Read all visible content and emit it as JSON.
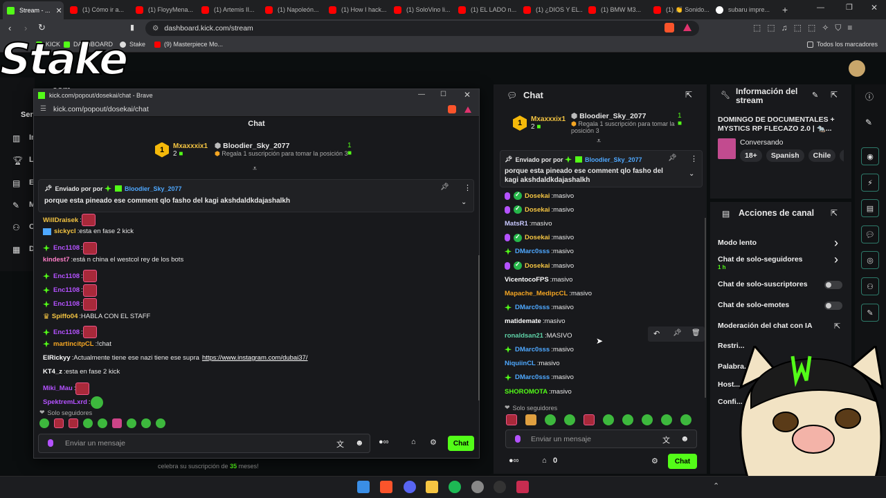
{
  "browser": {
    "tabs": [
      {
        "label": "Stream - ...",
        "kind": "kick",
        "active": true
      },
      {
        "label": "(1) Cómo ir a...",
        "kind": "yt"
      },
      {
        "label": "(1) FloyyMena...",
        "kind": "yt"
      },
      {
        "label": "(1) Artemis II...",
        "kind": "yt"
      },
      {
        "label": "(1) Napoleón...",
        "kind": "yt"
      },
      {
        "label": "(1) How I hack...",
        "kind": "yt"
      },
      {
        "label": "(1) SoloVino li...",
        "kind": "yt"
      },
      {
        "label": "(1) EL LADO n...",
        "kind": "yt"
      },
      {
        "label": "(1) ¿DIOS Y EL...",
        "kind": "yt"
      },
      {
        "label": "(1) BMW M3...",
        "kind": "yt"
      },
      {
        "label": "(1) 👏 Sonido...",
        "kind": "yt"
      },
      {
        "label": "subaru impre...",
        "kind": "g"
      }
    ],
    "url": "dashboard.kick.com/stream",
    "bookmarks": [
      "KICK",
      "DASHBOARD",
      "Stake",
      "(9) Masterpiece Mo..."
    ],
    "all_bookmarks": "Todos los marcadores"
  },
  "logo": {
    "brand": "Stake",
    "suffix": ".com"
  },
  "popout": {
    "window_title": "kick.com/popout/dosekai/chat - Brave",
    "url": "kick.com/popout/dosekai/chat",
    "header": "Chat",
    "gift_rank": "1",
    "gift_user1": "Mxaxxxix1",
    "gift_user1_count": "2",
    "gift_user2": "Bloodier_Sky_2077",
    "gift_user2_count": "1",
    "gift_text": "Regala 1 suscripción para tomar la posición 3",
    "pinned_by_label": "Enviado por",
    "pinned_by_user": "Bloodier_Sky_2077",
    "pinned_text": "porque esta pineado ese comment qlo fasho del kagi akshdaldkdajashalkh",
    "messages": [
      {
        "user": "WillDraisek",
        "color": "#f5c542",
        "badge": "",
        "text": "",
        "emote": true
      },
      {
        "user": "sickycl",
        "color": "#f5c542",
        "badge": "blue",
        "text": "esta en fase 2 kick"
      },
      {
        "user": "Enc1108",
        "color": "#b452ff",
        "badge": "g",
        "text": "",
        "emote": true
      },
      {
        "user": "kindest7",
        "color": "#ff7ec7",
        "badge": "",
        "text": "está n china el westcol rey de los bots"
      },
      {
        "user": "Enc1108",
        "color": "#b452ff",
        "badge": "g",
        "text": "",
        "emote": true
      },
      {
        "user": "Enc1108",
        "color": "#b452ff",
        "badge": "g",
        "text": "",
        "emote": true
      },
      {
        "user": "Enc1108",
        "color": "#b452ff",
        "badge": "g",
        "text": "",
        "emote": true
      },
      {
        "user": "Spiffo04",
        "color": "#f5c542",
        "badge": "crown",
        "text": "HABLA CON EL STAFF"
      },
      {
        "user": "Enc1108",
        "color": "#b452ff",
        "badge": "g",
        "text": "",
        "emote": true
      },
      {
        "user": "martincitpCL",
        "color": "#f5a623",
        "badge": "g",
        "text": "!chat"
      },
      {
        "user": "ElRickyy",
        "color": "#ffffff",
        "badge": "",
        "text": "Actualmente tiene ese nazi tiene ese supra",
        "link": "https://www.instagram.com/dubai37/"
      },
      {
        "user": "KT4_z",
        "color": "#ffffff",
        "badge": "",
        "text": "esta en fase 2 kick"
      },
      {
        "user": "Miki_Mau",
        "color": "#b452ff",
        "badge": "",
        "text": "",
        "emote": true
      },
      {
        "user": "SpektremLxrd",
        "color": "#b452ff",
        "badge": "",
        "text": "",
        "emote": true
      }
    ],
    "followers_only": "Solo seguidores",
    "input_placeholder": "Enviar un mensaje",
    "chat_button": "Chat"
  },
  "chat_panel": {
    "title": "Chat",
    "gift_rank": "1",
    "gift_user1": "Mxaxxxix1",
    "gift_user1_count": "2",
    "gift_user2": "Bloodier_Sky_2077",
    "gift_user2_count": "1",
    "gift_text": "Regala 1 suscripción para tomar la posición 3",
    "pinned_by_label": "Enviado por",
    "pinned_by_user": "Bloodier_Sky_2077",
    "pinned_text": "porque esta pineado ese comment qlo fasho del kagi akshdaldkdajashalkh",
    "messages": [
      {
        "user": "Dosekai",
        "color": "#f5c542",
        "badges": [
          "p",
          "v"
        ],
        "text": "masivo"
      },
      {
        "user": "Dosekai",
        "color": "#f5c542",
        "badges": [
          "p",
          "v"
        ],
        "text": "masivo"
      },
      {
        "user": "MatsR1",
        "color": "#c9c9ff",
        "badges": [],
        "text": "masivo"
      },
      {
        "user": "Dosekai",
        "color": "#f5c542",
        "badges": [
          "p",
          "v"
        ],
        "text": "masivo"
      },
      {
        "user": "DMarc0sss",
        "color": "#4ea8ff",
        "badges": [
          "g"
        ],
        "text": "masivo"
      },
      {
        "user": "Dosekai",
        "color": "#f5c542",
        "badges": [
          "p",
          "v"
        ],
        "text": "masivo"
      },
      {
        "user": "VicentocoFPS",
        "color": "#ffffff",
        "badges": [],
        "text": "masivo"
      },
      {
        "user": "Mapache_MedipcCL",
        "color": "#f5a623",
        "badges": [],
        "text": "masivo"
      },
      {
        "user": "DMarc0sss",
        "color": "#4ea8ff",
        "badges": [
          "g"
        ],
        "text": "masivo"
      },
      {
        "user": "matidemate",
        "color": "#ffffff",
        "badges": [],
        "text": "masivo"
      },
      {
        "user": "ronaldsan21",
        "color": "#5fd3a8",
        "badges": [],
        "text": "MASIVO"
      },
      {
        "user": "DMarc0sss",
        "color": "#4ea8ff",
        "badges": [
          "g"
        ],
        "text": "masivo"
      },
      {
        "user": "NiquiinCL",
        "color": "#4ea8ff",
        "badges": [],
        "text": "masivo"
      },
      {
        "user": "DMarc0sss",
        "color": "#4ea8ff",
        "badges": [
          "g"
        ],
        "text": "masivo"
      },
      {
        "user": "SHOROMOTA",
        "color": "#53fc18",
        "badges": [],
        "text": "masivo"
      }
    ],
    "followers_only": "Solo seguidores",
    "input_placeholder": "Enviar un mensaje",
    "points": "0",
    "chat_button": "Chat"
  },
  "stream_info": {
    "title": "Información del stream",
    "stream_title": "DOMINGO DE DOCUMENTALES + MYSTICS RP FLECAZO 2.0 | 🐀...",
    "category": "Conversando",
    "tags": [
      "18+",
      "Spanish",
      "Chile",
      "c"
    ]
  },
  "channel_actions": {
    "title": "Acciones de canal",
    "items": [
      {
        "label": "Modo lento",
        "sub": "",
        "control": "chevron"
      },
      {
        "label": "Chat de solo-seguidores",
        "sub": "1 h",
        "control": "chevron"
      },
      {
        "label": "Chat de solo-suscriptores",
        "sub": "",
        "control": "toggle"
      },
      {
        "label": "Chat de solo-emotes",
        "sub": "",
        "control": "toggle"
      },
      {
        "label": "Moderación del chat con IA",
        "sub": "",
        "control": "external"
      },
      {
        "label": "Restri...",
        "sub": "",
        "control": ""
      },
      {
        "label": "Palabra...",
        "sub": "",
        "control": ""
      },
      {
        "label": "Host...",
        "sub": "",
        "control": ""
      },
      {
        "label": "Confi...",
        "sub": "",
        "control": ""
      }
    ]
  },
  "left_nav": [
    "S",
    "Ser",
    "In",
    "L",
    "E",
    "M",
    "C",
    "D"
  ],
  "bottom_sub_notice": {
    "prefix": "celebra su suscripción de",
    "months": "35",
    "suffix": "meses!"
  },
  "colors": {
    "kick_green": "#53fc18",
    "panel": "#18191c",
    "bg": "#0b0e0f"
  }
}
